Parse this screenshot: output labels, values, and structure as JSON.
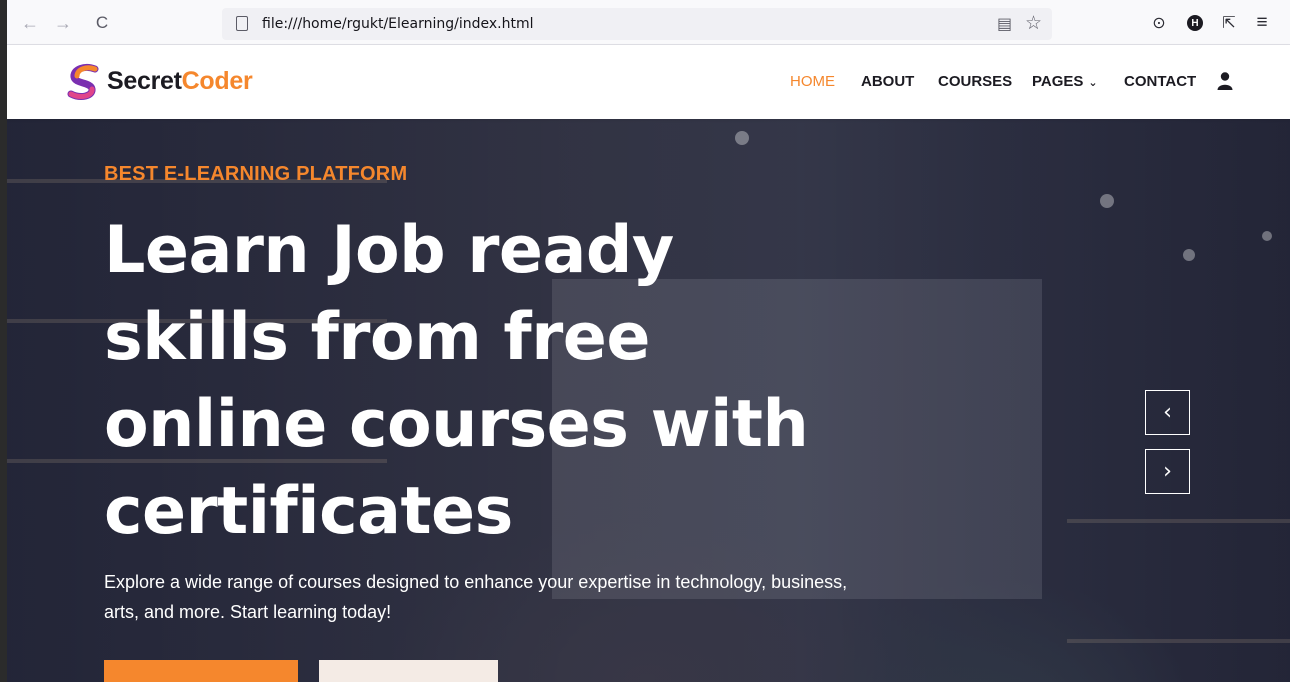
{
  "browser": {
    "url": "file:///home/rgukt/Elearning/index.html",
    "icons": [
      "back-arrow-icon",
      "forward-arrow-icon",
      "reload-icon",
      "page-icon",
      "reader-view-icon",
      "bookmark-star-icon",
      "pocket-icon",
      "profile-badge-icon",
      "extensions-icon",
      "menu-icon"
    ],
    "back_glyph": "←",
    "forward_glyph": "→",
    "reload_glyph": "C",
    "reader_glyph": "▤",
    "star_glyph": "☆",
    "pocket_glyph": "⊙",
    "profile_letter": "H",
    "extensions_glyph": "⇱",
    "menu_glyph": "≡"
  },
  "site": {
    "logo": {
      "part1": "Secret",
      "part2": "Coder"
    },
    "nav": {
      "home": "HOME",
      "about": "ABOUT",
      "courses": "COURSES",
      "pages": "PAGES",
      "contact": "CONTACT"
    },
    "chevron_glyph": "⌄"
  },
  "hero": {
    "eyebrow": "BEST E-LEARNING PLATFORM",
    "title_lines": [
      "Learn Job ready",
      "skills from free",
      "online courses with",
      "certificates"
    ],
    "description": "Explore a wide range of courses designed to enhance your expertise in technology, business, arts, and more. Start learning today!",
    "prev_glyph": "‹",
    "next_glyph": "›"
  },
  "colors": {
    "accent": "#f5872d",
    "overlay": "#181d38",
    "secondary_button": "#f4ebe5"
  }
}
